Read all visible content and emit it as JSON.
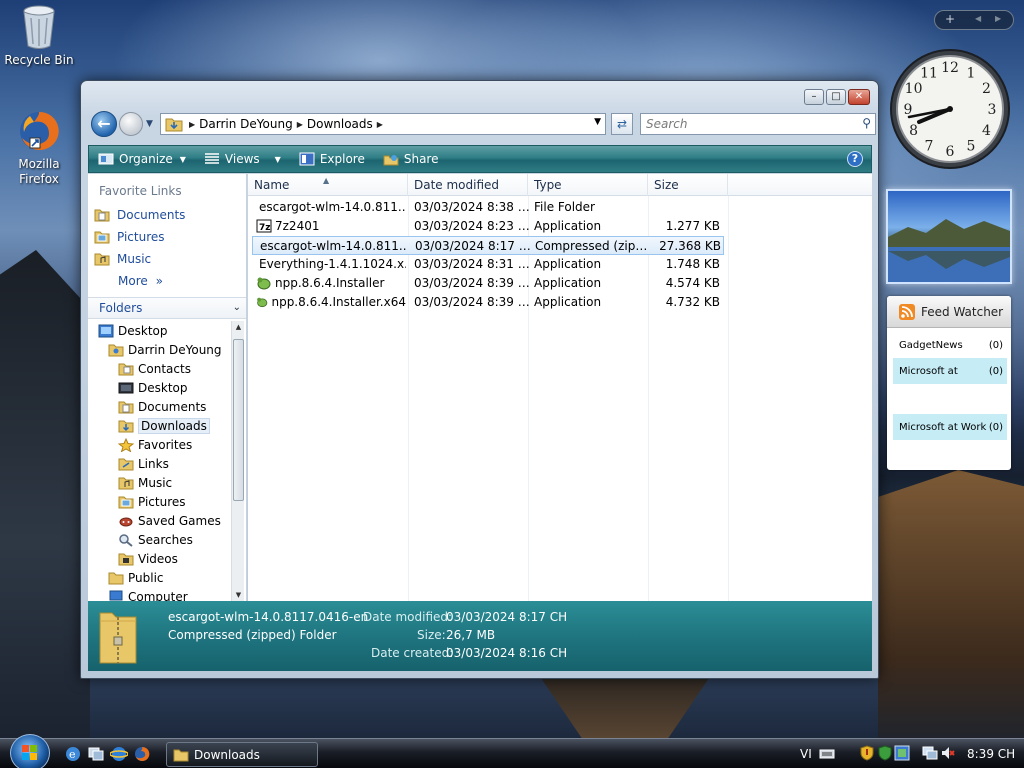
{
  "desktop": {
    "icons": [
      {
        "label": "Recycle Bin",
        "icon": "recycle-bin-icon"
      },
      {
        "label": "Mozilla Firefox",
        "icon": "firefox-icon"
      }
    ]
  },
  "window": {
    "address": {
      "crumbs": [
        "Darrin DeYoung",
        "Downloads"
      ]
    },
    "search": {
      "placeholder": "Search"
    },
    "toolbar": {
      "organize": "Organize",
      "views": "Views",
      "explore": "Explore",
      "share": "Share"
    },
    "favorite_links": {
      "heading": "Favorite Links",
      "items": [
        {
          "label": "Documents",
          "icon": "documents-folder-icon"
        },
        {
          "label": "Pictures",
          "icon": "pictures-folder-icon"
        },
        {
          "label": "Music",
          "icon": "music-folder-icon"
        }
      ],
      "more": "More"
    },
    "folders": {
      "heading": "Folders",
      "tree": [
        {
          "label": "Desktop",
          "level": 0,
          "icon": "desktop-icon"
        },
        {
          "label": "Darrin DeYoung",
          "level": 1,
          "icon": "user-folder-icon"
        },
        {
          "label": "Contacts",
          "level": 2,
          "icon": "contacts-folder-icon"
        },
        {
          "label": "Desktop",
          "level": 2,
          "icon": "desktop-folder-icon"
        },
        {
          "label": "Documents",
          "level": 2,
          "icon": "documents-folder-icon"
        },
        {
          "label": "Downloads",
          "level": 2,
          "icon": "downloads-folder-icon",
          "selected": true
        },
        {
          "label": "Favorites",
          "level": 2,
          "icon": "favorites-star-icon"
        },
        {
          "label": "Links",
          "level": 2,
          "icon": "links-folder-icon"
        },
        {
          "label": "Music",
          "level": 2,
          "icon": "music-folder-icon"
        },
        {
          "label": "Pictures",
          "level": 2,
          "icon": "pictures-folder-icon"
        },
        {
          "label": "Saved Games",
          "level": 2,
          "icon": "saved-games-icon"
        },
        {
          "label": "Searches",
          "level": 2,
          "icon": "searches-icon"
        },
        {
          "label": "Videos",
          "level": 2,
          "icon": "videos-folder-icon"
        },
        {
          "label": "Public",
          "level": 1,
          "icon": "public-folder-icon"
        },
        {
          "label": "Computer",
          "level": 1,
          "icon": "computer-icon"
        }
      ]
    },
    "columns": [
      "Name",
      "Date modified",
      "Type",
      "Size"
    ],
    "files": [
      {
        "name": "escargot-wlm-14.0.811...",
        "date": "03/03/2024 8:38 CH",
        "type": "File Folder",
        "size": "",
        "icon": "folder-icon"
      },
      {
        "name": "7z2401",
        "date": "03/03/2024 8:23 CH",
        "type": "Application",
        "size": "1.277 KB",
        "icon": "7zip-icon"
      },
      {
        "name": "escargot-wlm-14.0.811...",
        "date": "03/03/2024 8:17 CH",
        "type": "Compressed (zipp...",
        "size": "27.368 KB",
        "icon": "zip-folder-icon",
        "selected": true
      },
      {
        "name": "Everything-1.4.1.1024.x...",
        "date": "03/03/2024 8:31 CH",
        "type": "Application",
        "size": "1.748 KB",
        "icon": "everything-search-icon"
      },
      {
        "name": "npp.8.6.4.Installer",
        "date": "03/03/2024 8:39 CH",
        "type": "Application",
        "size": "4.574 KB",
        "icon": "notepad-plus-icon"
      },
      {
        "name": "npp.8.6.4.Installer.x64",
        "date": "03/03/2024 8:39 CH",
        "type": "Application",
        "size": "4.732 KB",
        "icon": "notepad-plus-icon"
      }
    ],
    "details": {
      "filename": "escargot-wlm-14.0.8117.0416-en",
      "filetype": "Compressed (zipped) Folder",
      "date_modified_label": "Date modified:",
      "date_modified": "03/03/2024 8:17 CH",
      "size_label": "Size:",
      "size": "26,7 MB",
      "date_created_label": "Date created:",
      "date_created": "03/03/2024 8:16 CH"
    }
  },
  "taskbar": {
    "task": "Downloads",
    "language": "VI",
    "time": "8:39 CH"
  },
  "gadgets": {
    "clock": {
      "numbers": [
        "12",
        "1",
        "2",
        "3",
        "4",
        "5",
        "6",
        "7",
        "8",
        "9",
        "10",
        "11"
      ]
    },
    "feed_watcher": {
      "title": "Feed Watcher",
      "items": [
        {
          "label": "GadgetNews",
          "count": "(0)"
        },
        {
          "label": "Microsoft at",
          "count": "(0)"
        },
        {
          "label": "Microsoft at Work",
          "count": "(0)"
        }
      ]
    }
  }
}
